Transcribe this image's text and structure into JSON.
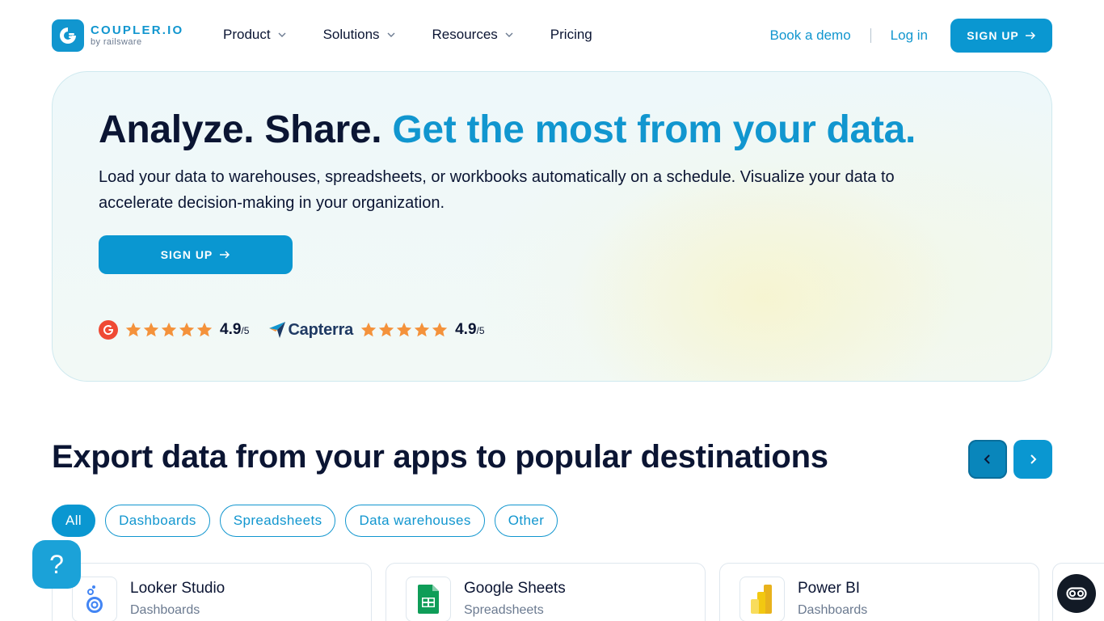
{
  "brand": {
    "name": "COUPLER.IO",
    "sub": "by railsware",
    "color": "#1196cf"
  },
  "nav": {
    "items": [
      {
        "label": "Product",
        "dropdown": true
      },
      {
        "label": "Solutions",
        "dropdown": true
      },
      {
        "label": "Resources",
        "dropdown": true
      },
      {
        "label": "Pricing",
        "dropdown": false
      }
    ],
    "book_demo": "Book a demo",
    "login": "Log in",
    "signup": "SIGN UP"
  },
  "hero": {
    "title_dark": "Analyze. Share.",
    "title_accent": "Get the most from your data.",
    "description": "Load your data to warehouses, spreadsheets, or workbooks automatically on a schedule. Visualize your data to accelerate decision-making in your organization.",
    "signup": "SIGN UP",
    "ratings": [
      {
        "source": "G2",
        "stars": 5,
        "score": "4.9",
        "max": "/5"
      },
      {
        "source": "Capterra",
        "stars": 5,
        "score": "4.9",
        "max": "/5"
      }
    ]
  },
  "section": {
    "title": "Export data from your apps to popular destinations",
    "filters": [
      "All",
      "Dashboards",
      "Spreadsheets",
      "Data warehouses",
      "Other"
    ],
    "active_filter": "All",
    "cards": [
      {
        "title": "Looker Studio",
        "category": "Dashboards",
        "icon": "looker-studio-icon"
      },
      {
        "title": "Google Sheets",
        "category": "Spreadsheets",
        "icon": "google-sheets-icon"
      },
      {
        "title": "Power BI",
        "category": "Dashboards",
        "icon": "power-bi-icon"
      }
    ]
  },
  "help": {
    "label": "?"
  },
  "colors": {
    "accent": "#0a97d1",
    "star": "#f4923b",
    "dark": "#0b1533"
  }
}
